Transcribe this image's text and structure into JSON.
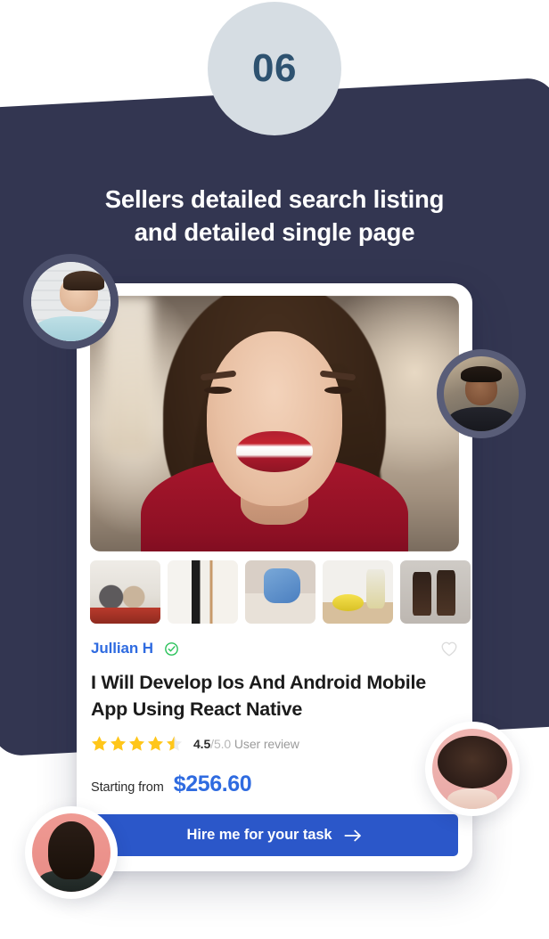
{
  "slide": {
    "number": "06",
    "headline_line1": "Sellers detailed search listing",
    "headline_line2": "and detailed single page",
    "panel_color": "#333651",
    "badge_bg": "#d6dde3",
    "badge_text_color": "#2e5270"
  },
  "card": {
    "seller": {
      "name": "Jullian H",
      "name_color": "#2f6be0",
      "verified_icon": "check-circle-icon",
      "verified_color": "#2bc25b",
      "favorite_icon": "heart-outline-icon",
      "favorite_color": "#d9d9d9"
    },
    "title": "I Will Develop Ios And Android Mobile App Using React Native",
    "rating": {
      "value": 4.5,
      "max": 5.0,
      "score_text": "4.5",
      "out_of_text": "/5.0",
      "label": "User review",
      "stars_filled": 4,
      "stars_half": 1,
      "stars_total": 5,
      "star_color": "#ffc61a",
      "star_empty_color": "#ececec"
    },
    "price": {
      "label": "Starting from",
      "amount": "$256.60",
      "amount_color": "#2f6be0"
    },
    "cta": {
      "label": "Hire me for your task",
      "arrow_icon": "arrow-right-icon",
      "background": "#2b57c9"
    },
    "gallery": {
      "hero_alt": "smiling-woman-portrait",
      "thumbnails": [
        {
          "alt": "couple-cooking-in-kitchen"
        },
        {
          "alt": "cleaning-tools-on-wall"
        },
        {
          "alt": "gloved-hands-spraying-cleaner"
        },
        {
          "alt": "lemons-and-spray-bottle"
        },
        {
          "alt": "amber-spray-bottles"
        }
      ]
    }
  },
  "avatars": [
    {
      "name": "avatar-top-left",
      "alt": "man-in-light-blue-shirt"
    },
    {
      "name": "avatar-mid-right",
      "alt": "young-man-dark-shirt"
    },
    {
      "name": "avatar-lower-right",
      "alt": "woman-with-afro-pink-background"
    },
    {
      "name": "avatar-bottom-left",
      "alt": "woman-dark-top-pink-background"
    }
  ]
}
